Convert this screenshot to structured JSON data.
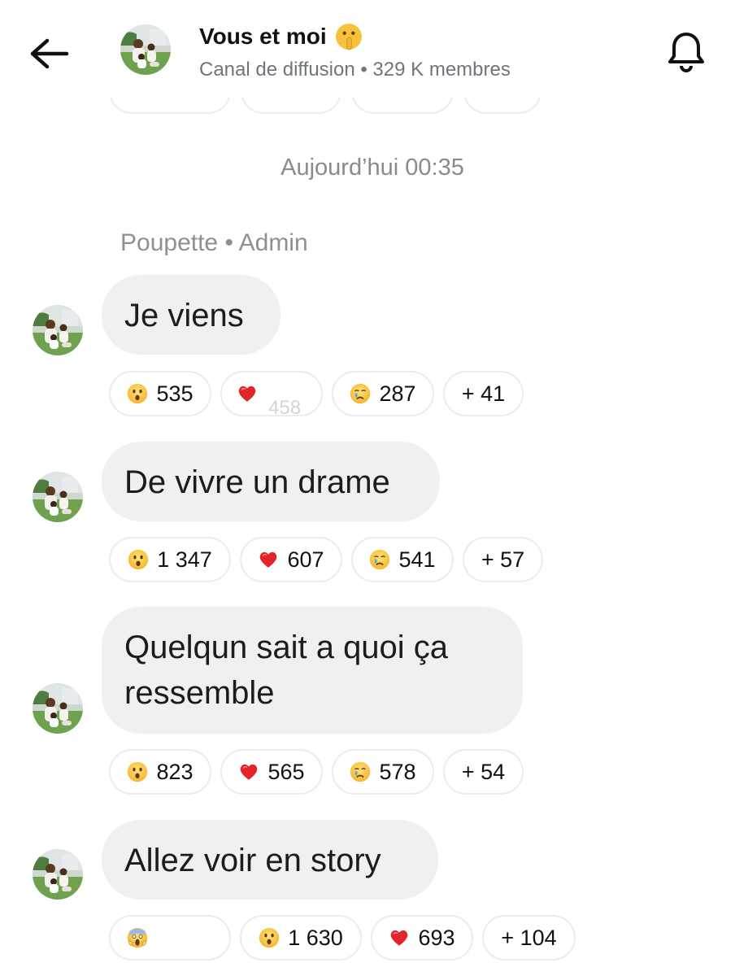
{
  "header": {
    "title": "Vous et moi",
    "title_emoji": "shushing-face-emoji",
    "subtitle": "Canal de diffusion • 329 K membres",
    "back_icon": "arrow-left-icon",
    "bell_icon": "bell-icon"
  },
  "timestamp": "Aujourd’hui 00:35",
  "sender": "Poupette • Admin",
  "messages": [
    {
      "text": "Je viens",
      "reactions": [
        {
          "emoji": "surprised-face-emoji",
          "count": "535"
        },
        {
          "emoji": "red-heart-emoji",
          "count": "",
          "faded_count": "458"
        },
        {
          "emoji": "crying-face-emoji",
          "count": "287"
        },
        {
          "emoji": "",
          "count": "+ 41"
        }
      ]
    },
    {
      "text": "De vivre un drame",
      "reactions": [
        {
          "emoji": "surprised-face-emoji",
          "count": "1 347"
        },
        {
          "emoji": "red-heart-emoji",
          "count": "607"
        },
        {
          "emoji": "crying-face-emoji",
          "count": "541"
        },
        {
          "emoji": "",
          "count": "+ 57"
        }
      ]
    },
    {
      "text_line1": "Quelqun sait a quoi ça",
      "text_line2": "ressemble",
      "reactions": [
        {
          "emoji": "surprised-face-emoji",
          "count": "823"
        },
        {
          "emoji": "red-heart-emoji",
          "count": "565"
        },
        {
          "emoji": "crying-face-emoji",
          "count": "578"
        },
        {
          "emoji": "",
          "count": "+ 54"
        }
      ]
    },
    {
      "text": "Allez voir en story",
      "reactions": [
        {
          "emoji": "screaming-face-emoji",
          "count": ""
        },
        {
          "emoji": "surprised-face-emoji",
          "count": "1 630"
        },
        {
          "emoji": "red-heart-emoji",
          "count": "693"
        },
        {
          "emoji": "",
          "count": "+ 104"
        }
      ]
    }
  ],
  "colors": {
    "bubble": "#f0f0f0",
    "pill_border": "#ececec",
    "muted_text": "#8f8f94"
  }
}
